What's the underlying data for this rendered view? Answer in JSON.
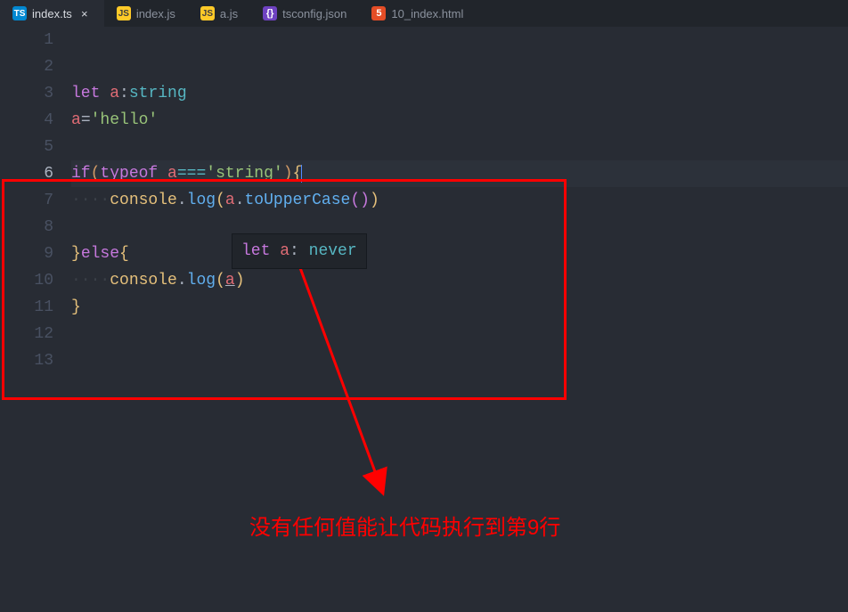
{
  "tabs": [
    {
      "icon": "ts",
      "label": "index.ts",
      "active": true
    },
    {
      "icon": "js",
      "label": "index.js",
      "active": false
    },
    {
      "icon": "js",
      "label": "a.js",
      "active": false
    },
    {
      "icon": "json",
      "label": "tsconfig.json",
      "active": false
    },
    {
      "icon": "html",
      "label": "10_index.html",
      "active": false
    }
  ],
  "tab_icons": {
    "ts": "TS",
    "js": "JS",
    "json": "{}",
    "html": "5"
  },
  "close_glyph": "×",
  "line_numbers": [
    "1",
    "2",
    "3",
    "4",
    "5",
    "6",
    "7",
    "8",
    "9",
    "10",
    "11",
    "12",
    "13"
  ],
  "active_line": 6,
  "code": {
    "l3": {
      "let": "let",
      "sp": " ",
      "a": "a",
      "colon": ":",
      "type": "string"
    },
    "l4": {
      "a": "a",
      "eq": "=",
      "str": "'hello'"
    },
    "l6": {
      "if": "if",
      "lp": "(",
      "typeof": "typeof",
      "sp": " ",
      "a": "a",
      "op": "===",
      "str": "'string'",
      "rp": ")",
      "ob": "{"
    },
    "l7": {
      "indent": "····",
      "console": "console",
      "dot": ".",
      "log": "log",
      "lp": "(",
      "a": "a",
      "dot2": ".",
      "fn": "toUpperCase",
      "lp2": "(",
      "rp2": ")",
      "rp": ")"
    },
    "l9": {
      "cb": "}",
      "else": "else",
      "ob": "{"
    },
    "l10": {
      "indent": "····",
      "console": "console",
      "dot": ".",
      "log": "log",
      "lp": "(",
      "a": "a",
      "rp": ")"
    },
    "l11": {
      "cb": "}"
    }
  },
  "hover": {
    "let": "let",
    "sp": " ",
    "a": "a",
    "colon": ": ",
    "type": "never"
  },
  "annotation_text": "没有任何值能让代码执行到第9行"
}
